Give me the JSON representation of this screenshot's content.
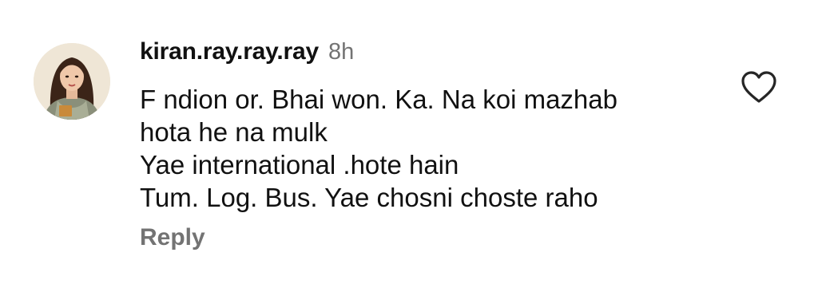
{
  "comment": {
    "username": "kiran.ray.ray.ray",
    "timestamp": "8h",
    "lines": [
      "F  ndion or. Bhai won. Ka. Na koi mazhab",
      "hota he na mulk",
      "Yae international .hote hain",
      "Tum. Log. Bus. Yae chosni choste raho"
    ],
    "reply_label": "Reply",
    "avatar": "profile-photo-avatar",
    "like_icon": "heart-outline-icon"
  },
  "colors": {
    "text_primary": "#111111",
    "text_secondary": "#737373",
    "background": "#ffffff"
  }
}
